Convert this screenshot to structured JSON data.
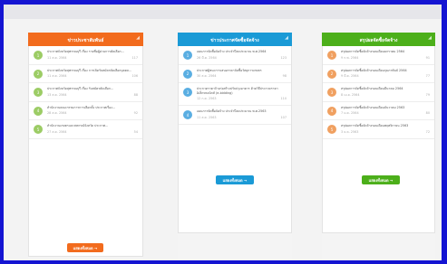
{
  "columns": [
    {
      "title": "ข่าวประชาสัมพันธ์",
      "color": "#f26b1d",
      "badge_color": "#9ccc65",
      "more_label": "แสดงทั้งหมด →",
      "items": [
        {
          "title": "ประกาศจังหวัดสุพรรณบุรี เรื่อง รายชื่อผู้ผ่านการคัดเลือก...",
          "date": "11 ส.ค. 2564",
          "count": "117"
        },
        {
          "title": "ประกาศจังหวัดสุพรรณบุรี เรื่อง การเปิดรับสมัครคัดเลือกบุคคล...",
          "date": "11 ส.ค. 2564",
          "count": "106"
        },
        {
          "title": "ประกาศจังหวัดสุพรรณบุรี เรื่อง รับสมัครคัดเลือก...",
          "date": "13 ส.ค. 2564",
          "count": "88"
        },
        {
          "title": "สำนักงานคณะกรรมการการเลือกตั้ง ประกาศเรื่อง...",
          "date": "28 ส.ค. 2564",
          "count": "92"
        },
        {
          "title": "สำนักงานเกษตรและสหกรณ์จังหวัด ประกาศ...",
          "date": "27 ส.ค. 2564",
          "count": "54"
        }
      ]
    },
    {
      "title": "ข่าวประกาศจัดซื้อจัดจ้าง",
      "color": "#1a9ad6",
      "badge_color": "#5aaee2",
      "more_label": "แสดงทั้งหมด →",
      "items": [
        {
          "title": "แผนการจัดซื้อจัดจ้าง ประจำปีงบประมาณ พ.ศ.2564",
          "date": "26 มี.ค. 2564",
          "count": "123"
        },
        {
          "title": "ประกาศผู้ชนะการเสนอราคาจัดซื้อวัสดุการเกษตร",
          "date": "30 ส.ค. 2564",
          "count": "98"
        },
        {
          "title": "ประกวดราคาจ้างก่อสร้างปรับปรุงอาคาร ด้วยวิธีประกวดราคาอิเล็กทรอนิกส์ (e-bidding)",
          "date": "12 ก.ค. 2563",
          "count": "110"
        },
        {
          "title": "แผนการจัดซื้อจัดจ้าง ประจำปีงบประมาณ พ.ศ.2563",
          "date": "11 ส.ค. 2563",
          "count": "107"
        }
      ]
    },
    {
      "title": "สรุปผลจัดซื้อจัดจ้าง",
      "color": "#4caf1a",
      "badge_color": "#f0a060",
      "more_label": "แสดงทั้งหมด →",
      "items": [
        {
          "title": "สรุปผลการจัดซื้อจัดจ้างรอบเดือนมกราคม 2564",
          "date": "9 ก.พ. 2564",
          "count": "91"
        },
        {
          "title": "สรุปผลการจัดซื้อจัดจ้างรอบเดือนกุมภาพันธ์ 2564",
          "date": "9 มี.ค. 2564",
          "count": "77"
        },
        {
          "title": "สรุปผลการจัดซื้อจัดจ้างรอบเดือนมีนาคม 2564",
          "date": "8 เม.ย. 2564",
          "count": "79"
        },
        {
          "title": "สรุปผลการจัดซื้อจัดจ้างรอบเดือนธันวาคม 2563",
          "date": "7 ม.ค. 2564",
          "count": "80"
        },
        {
          "title": "สรุปผลการจัดซื้อจัดจ้างรอบเดือนพฤศจิกายน 2563",
          "date": "3 ธ.ค. 2563",
          "count": "72"
        }
      ]
    }
  ]
}
